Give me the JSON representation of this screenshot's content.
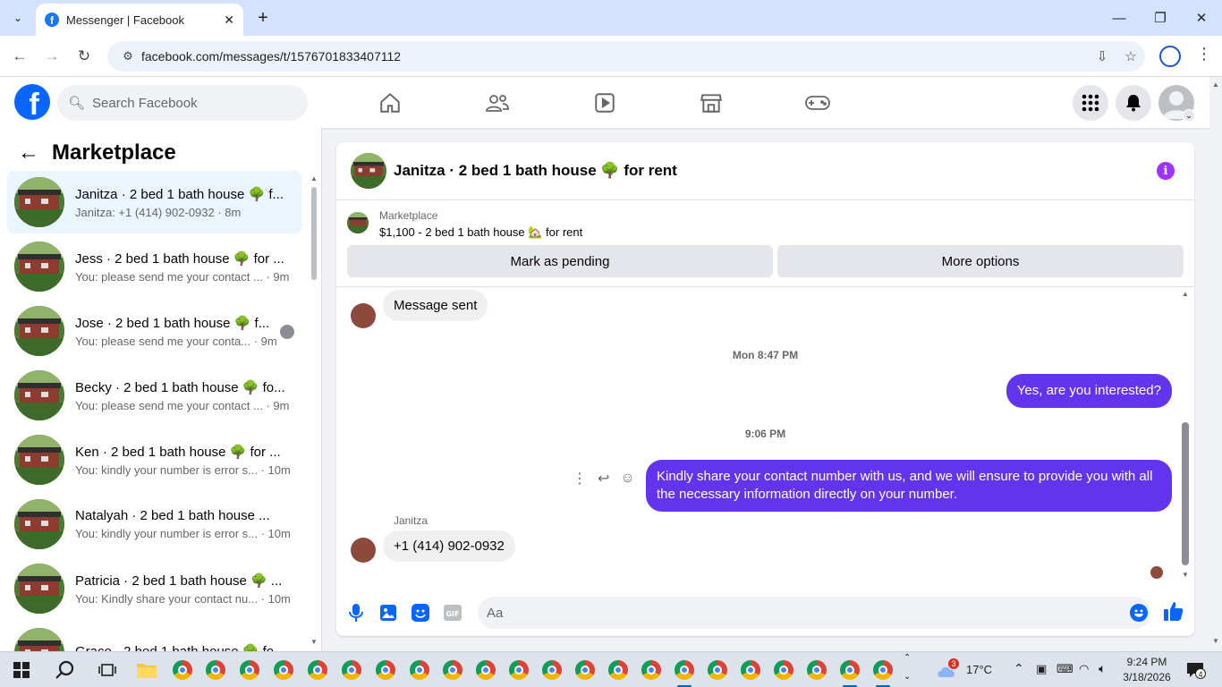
{
  "browser": {
    "tab_title": "Messenger | Facebook",
    "url": "facebook.com/messages/t/1576701833407112"
  },
  "fb": {
    "search_placeholder": "Search Facebook"
  },
  "sidebar": {
    "title": "Marketplace",
    "conversations": [
      {
        "name": "Janitza · 2 bed 1 bath house 🌳 f...",
        "preview": "Janitza: +1 (414) 902-0932 · 8m",
        "active": true
      },
      {
        "name": "Jess · 2 bed 1 bath house 🌳 for ...",
        "preview": "You: please send me your contact ... · 9m"
      },
      {
        "name": "Jose · 2 bed 1 bath house 🌳 f...",
        "preview": "You: please send me your conta... · 9m"
      },
      {
        "name": "Becky · 2 bed 1 bath house 🌳 fo...",
        "preview": "You: please send me your contact ... · 9m"
      },
      {
        "name": "Ken · 2 bed 1 bath house 🌳 for ...",
        "preview": "You: kindly your number is error s... · 10m"
      },
      {
        "name": "Natalyah · 2 bed 1 bath house ...",
        "preview": "You: kindly your number is error s... · 10m"
      },
      {
        "name": "Patricia · 2 bed 1 bath house 🌳 ...",
        "preview": "You: Kindly share your contact nu... · 10m"
      },
      {
        "name": "Grace · 2 bed 1 bath house 🌳 fo...",
        "preview": ""
      }
    ]
  },
  "chat": {
    "header_name": "Janitza · 2 bed 1 bath house 🌳 for rent",
    "marketplace_label": "Marketplace",
    "listing_title": "$1,100 - 2 bed 1 bath house 🏡 for rent",
    "mark_pending_label": "Mark as pending",
    "more_options_label": "More options",
    "messages": {
      "m1": "Message sent",
      "ts1": "Mon 8:47 PM",
      "m2": "Yes, are you interested?",
      "ts2": "9:06 PM",
      "m3": "Kindly share your contact number with us, and we will ensure to provide you with all the necessary information directly on your number.",
      "sender": "Janitza",
      "m4": "+1 (414) 902-0932"
    },
    "input_placeholder": "Aa",
    "accent_color": "#6234ee"
  },
  "taskbar": {
    "weather_temp": "17°C",
    "weather_badge": "3",
    "time": "9:24 PM",
    "date": "3/18/2026",
    "notifications": "4"
  }
}
